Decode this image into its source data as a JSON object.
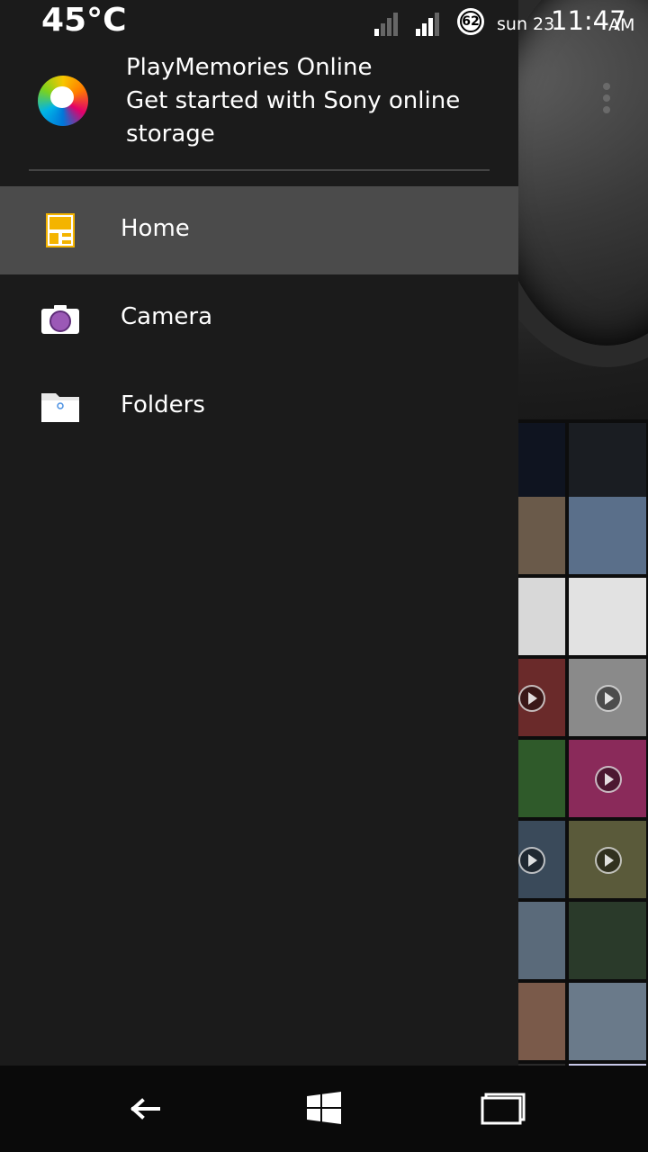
{
  "status_bar": {
    "temperature": "45°C",
    "battery_level": "62",
    "date": "sun 23",
    "time": "11:47",
    "ampm": "AM"
  },
  "drawer": {
    "account": {
      "name": "PlayMemories Online",
      "description": "Get started with Sony online storage"
    },
    "items": [
      {
        "label": "Home",
        "icon": "home-grid-icon",
        "active": true
      },
      {
        "label": "Camera",
        "icon": "camera-icon",
        "active": false
      },
      {
        "label": "Folders",
        "icon": "folder-icon",
        "active": false
      }
    ]
  },
  "gallery": {
    "overflow_icon": "more-vertical-icon"
  },
  "navigation_bar": {
    "back": "back-arrow-icon",
    "home": "windows-logo-icon",
    "recents": "recent-apps-icon"
  },
  "colors": {
    "drawer_bg": "#1b1b1b",
    "active_item_bg": "#4b4b4b",
    "home_icon": "#f4b400",
    "camera_lens": "#9b59b6"
  }
}
